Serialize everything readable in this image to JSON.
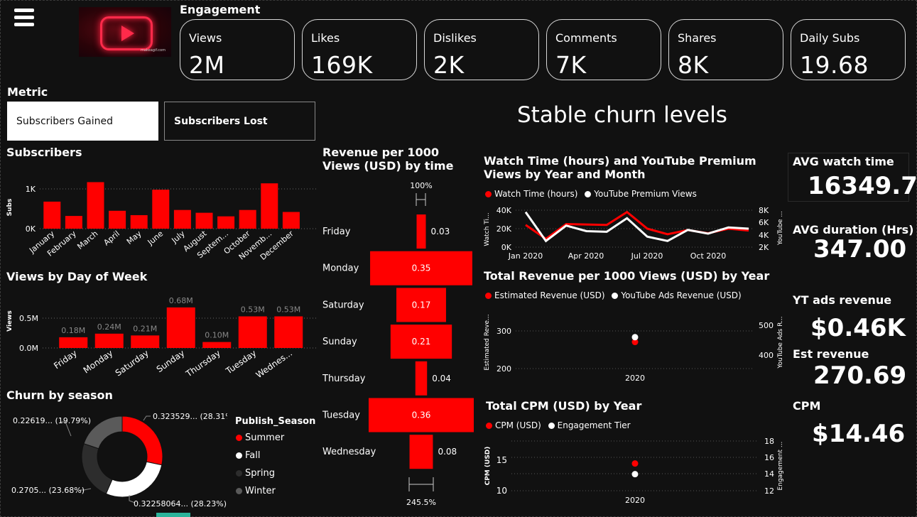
{
  "engagement": {
    "title": "Engagement",
    "cards": [
      {
        "label": "Views",
        "value": "2M"
      },
      {
        "label": "Likes",
        "value": "169K"
      },
      {
        "label": "Dislikes",
        "value": "2K"
      },
      {
        "label": "Comments",
        "value": "7K"
      },
      {
        "label": "Shares",
        "value": "8K"
      },
      {
        "label": "Daily Subs",
        "value": "19.68"
      }
    ]
  },
  "thumbnail": {
    "watermark": "makeagif.com",
    "icon": "youtube-play-icon"
  },
  "menu": {
    "icon": "hamburger-menu-icon"
  },
  "metric": {
    "title": "Metric",
    "options": [
      "Subscribers Gained",
      "Subscribers Lost"
    ],
    "selected": "Subscribers Gained"
  },
  "headline": "Stable churn levels",
  "kpis": {
    "avg_watch_time": {
      "label": "AVG watch time",
      "value": "16349.7"
    },
    "avg_duration": {
      "label": "AVG duration (Hrs)",
      "value": "347.00"
    },
    "yt_ads_revenue": {
      "label": "YT ads revenue",
      "value": "$0.46K"
    },
    "est_revenue": {
      "label": "Est revenue",
      "value": "270.69"
    },
    "cpm": {
      "label": "CPM",
      "value": "$14.46"
    }
  },
  "colors": {
    "accent": "#ff0000",
    "background": "#111111",
    "text": "#ffffff",
    "grey": "#555555",
    "dark": "#2d2d2d"
  },
  "chart_data": [
    {
      "id": "subscribers",
      "type": "bar",
      "title": "Subscribers",
      "ylabel": "Subs",
      "yticks": [
        "0K",
        "1K"
      ],
      "ylim": [
        0,
        1300
      ],
      "categories": [
        "January",
        "February",
        "March",
        "April",
        "May",
        "June",
        "July",
        "August",
        "Septem...",
        "October",
        "Novemb...",
        "December"
      ],
      "values": [
        680,
        320,
        1170,
        450,
        340,
        980,
        470,
        400,
        310,
        470,
        1140,
        420
      ]
    },
    {
      "id": "views_by_day",
      "type": "bar",
      "title": "Views by Day of Week",
      "ylabel": "Views",
      "yticks": [
        "0.0M",
        "0.5M"
      ],
      "ylim": [
        0,
        0.75
      ],
      "categories": [
        "Friday",
        "Monday",
        "Saturday",
        "Sunday",
        "Thursday",
        "Tuesday",
        "Wednes..."
      ],
      "values": [
        0.18,
        0.24,
        0.21,
        0.68,
        0.1,
        0.53,
        0.53
      ],
      "data_labels": [
        "0.18M",
        "0.24M",
        "0.21M",
        "0.68M",
        "0.10M",
        "0.53M",
        "0.53M"
      ]
    },
    {
      "id": "churn_by_season",
      "type": "pie",
      "title": "Churn by season",
      "legend_title": "Publish_Season",
      "categories": [
        "Summer",
        "Fall",
        "Spring",
        "Winter"
      ],
      "values": [
        28.31,
        28.23,
        23.68,
        19.79
      ],
      "data_labels": [
        "0.323529... (28.31%)",
        "0.32258064... (28.23%)",
        "0.2705... (23.68%)",
        "0.22619... (19.79%)"
      ],
      "colors": [
        "#ff0000",
        "#ffffff",
        "#2d2d2d",
        "#5a5a5a"
      ]
    },
    {
      "id": "revenue_per_1000",
      "type": "bar",
      "title": "Revenue per 1000 Views (USD) by time",
      "top_label": "100%",
      "bottom_label": "245.5%",
      "categories": [
        "Friday",
        "Monday",
        "Saturday",
        "Sunday",
        "Thursday",
        "Tuesday",
        "Wednesday"
      ],
      "values": [
        0.03,
        0.35,
        0.17,
        0.21,
        0.04,
        0.36,
        0.08
      ]
    },
    {
      "id": "watch_time",
      "type": "line",
      "title": "Watch Time (hours) and YouTube Premium Views by Year and Month",
      "xlabel": "",
      "ylabel": "Watch Ti...",
      "y2label": "YouTube ...",
      "x": [
        "Jan 2020",
        "Feb 2020",
        "Mar 2020",
        "Apr 2020",
        "May 2020",
        "Jun 2020",
        "Jul 2020",
        "Aug 2020",
        "Sep 2020",
        "Oct 2020",
        "Nov 2020",
        "Dec 2020"
      ],
      "xticks": [
        "Jan 2020",
        "Apr 2020",
        "Jul 2020",
        "Oct 2020"
      ],
      "yticks": [
        "0K",
        "20K",
        "40K"
      ],
      "y2ticks": [
        "2K",
        "4K",
        "6K",
        "8K"
      ],
      "ylim": [
        0,
        40000
      ],
      "y2lim": [
        2000,
        8000
      ],
      "series": [
        {
          "name": "Watch Time (hours)",
          "axis": "left",
          "color": "#ff0000",
          "values": [
            24000,
            9000,
            25000,
            24500,
            24000,
            38000,
            20000,
            14000,
            18500,
            15000,
            20000,
            18000
          ]
        },
        {
          "name": "YouTube Premium Views",
          "axis": "right",
          "color": "#ffffff",
          "values": [
            7700,
            3000,
            5500,
            4600,
            4500,
            6700,
            3700,
            3000,
            4800,
            4200,
            5200,
            5000
          ]
        }
      ]
    },
    {
      "id": "total_revenue",
      "type": "scatter",
      "title": "Total Revenue per 1000 Views (USD) by Year",
      "ylabel": "Estimated Reve...",
      "y2label": "YouTube Ads R...",
      "x": [
        "2020"
      ],
      "yticks": [
        "200",
        "300"
      ],
      "y2ticks": [
        "400",
        "500"
      ],
      "ylim": [
        180,
        330
      ],
      "y2lim": [
        350,
        530
      ],
      "series": [
        {
          "name": "Estimated Revenue (USD)",
          "axis": "left",
          "color": "#ff0000",
          "values": [
            270.69
          ]
        },
        {
          "name": "YouTube Ads Revenue (USD)",
          "axis": "right",
          "color": "#ffffff",
          "values": [
            460
          ]
        }
      ]
    },
    {
      "id": "total_cpm",
      "type": "scatter",
      "title": "Total CPM (USD) by Year",
      "ylabel": "CPM (USD)",
      "y2label": "Engagement ...",
      "x": [
        "2020"
      ],
      "yticks": [
        "10",
        "15"
      ],
      "y2ticks": [
        "12",
        "14",
        "16",
        "18"
      ],
      "ylim": [
        9,
        18
      ],
      "y2lim": [
        11.5,
        18.5
      ],
      "series": [
        {
          "name": "CPM (USD)",
          "axis": "left",
          "color": "#ff0000",
          "values": [
            14.46
          ]
        },
        {
          "name": "Engagement Tier",
          "axis": "right",
          "color": "#ffffff",
          "values": [
            14
          ]
        }
      ]
    }
  ]
}
